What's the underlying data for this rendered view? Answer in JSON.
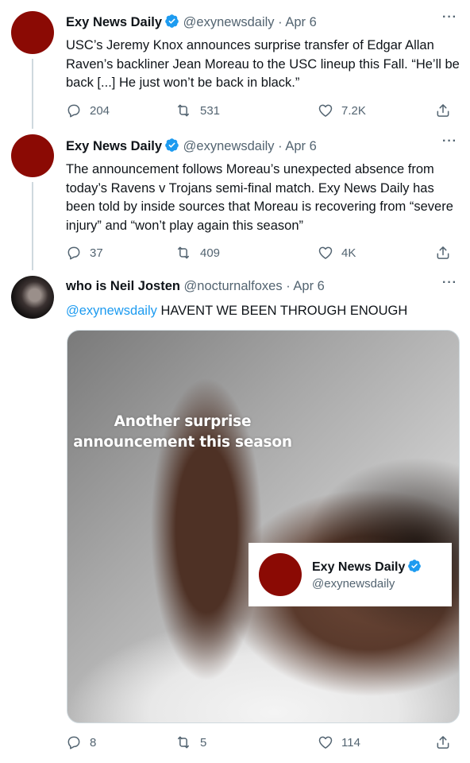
{
  "tweets": [
    {
      "author_name": "Exy News Daily",
      "handle": "@exynewsdaily",
      "separator": "·",
      "date": "Apr 6",
      "text": "USC’s Jeremy Knox announces surprise transfer of Edgar Allan Raven’s backliner Jean Moreau to the USC lineup this Fall. “He’ll be back [...] He just won’t be back in black.”",
      "replies": "204",
      "retweets": "531",
      "likes": "7.2K",
      "avatar_color": "#8b0a04"
    },
    {
      "author_name": "Exy News Daily",
      "handle": "@exynewsdaily",
      "separator": "·",
      "date": "Apr 6",
      "text": "The announcement follows Moreau’s unexpected absence from today’s Ravens v Trojans semi-final match. Exy News Daily has been told by inside sources that Moreau is recovering from “severe injury” and “won’t play again this season”",
      "replies": "37",
      "retweets": "409",
      "likes": "4K",
      "avatar_color": "#8b0a04"
    },
    {
      "author_name": "who is Neil Josten",
      "handle": "@nocturnalfoxes",
      "separator": "·",
      "date": "Apr 6",
      "mention": "@exynewsdaily",
      "text": " HAVENT WE BEEN THROUGH ENOUGH",
      "replies": "8",
      "retweets": "5",
      "likes": "114",
      "media": {
        "caption": "Another surprise announcement this season",
        "card_name": "Exy News Daily",
        "card_handle": "@exynewsdaily"
      }
    }
  ],
  "icons": {
    "more": "more-icon",
    "reply": "reply-icon",
    "retweet": "retweet-icon",
    "like": "heart-icon",
    "share": "share-icon",
    "verified": "verified-badge-icon"
  },
  "colors": {
    "accent": "#1d9bf0",
    "secondary_text": "#536471",
    "brand_red": "#8b0a04"
  }
}
